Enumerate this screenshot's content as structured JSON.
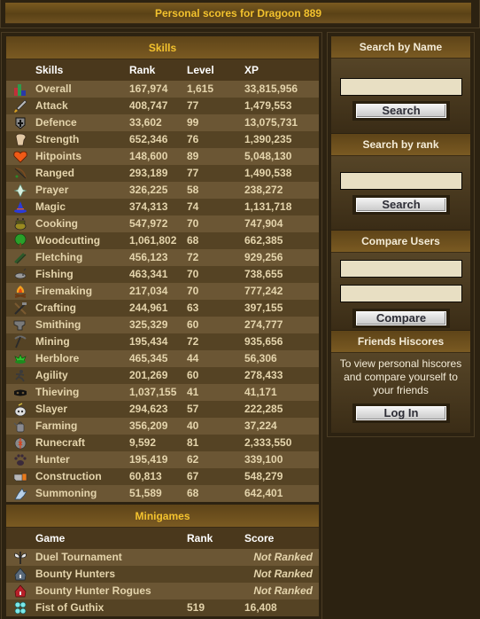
{
  "header": {
    "title": "Personal scores for Dragoon 889"
  },
  "skills": {
    "title": "Skills",
    "columns": [
      "Skills",
      "Rank",
      "Level",
      "XP"
    ],
    "rows": [
      {
        "icon": "overall-icon",
        "name": "Overall",
        "rank": "167,974",
        "level": "1,615",
        "xp": "33,815,956"
      },
      {
        "icon": "attack-icon",
        "name": "Attack",
        "rank": "408,747",
        "level": "77",
        "xp": "1,479,553"
      },
      {
        "icon": "defence-icon",
        "name": "Defence",
        "rank": "33,602",
        "level": "99",
        "xp": "13,075,731"
      },
      {
        "icon": "strength-icon",
        "name": "Strength",
        "rank": "652,346",
        "level": "76",
        "xp": "1,390,235"
      },
      {
        "icon": "hitpoints-icon",
        "name": "Hitpoints",
        "rank": "148,600",
        "level": "89",
        "xp": "5,048,130"
      },
      {
        "icon": "ranged-icon",
        "name": "Ranged",
        "rank": "293,189",
        "level": "77",
        "xp": "1,490,538"
      },
      {
        "icon": "prayer-icon",
        "name": "Prayer",
        "rank": "326,225",
        "level": "58",
        "xp": "238,272"
      },
      {
        "icon": "magic-icon",
        "name": "Magic",
        "rank": "374,313",
        "level": "74",
        "xp": "1,131,718"
      },
      {
        "icon": "cooking-icon",
        "name": "Cooking",
        "rank": "547,972",
        "level": "70",
        "xp": "747,904"
      },
      {
        "icon": "woodcutting-icon",
        "name": "Woodcutting",
        "rank": "1,061,802",
        "level": "68",
        "xp": "662,385"
      },
      {
        "icon": "fletching-icon",
        "name": "Fletching",
        "rank": "456,123",
        "level": "72",
        "xp": "929,256"
      },
      {
        "icon": "fishing-icon",
        "name": "Fishing",
        "rank": "463,341",
        "level": "70",
        "xp": "738,655"
      },
      {
        "icon": "firemaking-icon",
        "name": "Firemaking",
        "rank": "217,034",
        "level": "70",
        "xp": "777,242"
      },
      {
        "icon": "crafting-icon",
        "name": "Crafting",
        "rank": "244,961",
        "level": "63",
        "xp": "397,155"
      },
      {
        "icon": "smithing-icon",
        "name": "Smithing",
        "rank": "325,329",
        "level": "60",
        "xp": "274,777"
      },
      {
        "icon": "mining-icon",
        "name": "Mining",
        "rank": "195,434",
        "level": "72",
        "xp": "935,656"
      },
      {
        "icon": "herblore-icon",
        "name": "Herblore",
        "rank": "465,345",
        "level": "44",
        "xp": "56,306"
      },
      {
        "icon": "agility-icon",
        "name": "Agility",
        "rank": "201,269",
        "level": "60",
        "xp": "278,433"
      },
      {
        "icon": "thieving-icon",
        "name": "Thieving",
        "rank": "1,037,155",
        "level": "41",
        "xp": "41,171"
      },
      {
        "icon": "slayer-icon",
        "name": "Slayer",
        "rank": "294,623",
        "level": "57",
        "xp": "222,285"
      },
      {
        "icon": "farming-icon",
        "name": "Farming",
        "rank": "356,209",
        "level": "40",
        "xp": "37,224"
      },
      {
        "icon": "runecraft-icon",
        "name": "Runecraft",
        "rank": "9,592",
        "level": "81",
        "xp": "2,333,550"
      },
      {
        "icon": "hunter-icon",
        "name": "Hunter",
        "rank": "195,419",
        "level": "62",
        "xp": "339,100"
      },
      {
        "icon": "construction-icon",
        "name": "Construction",
        "rank": "60,813",
        "level": "67",
        "xp": "548,279"
      },
      {
        "icon": "summoning-icon",
        "name": "Summoning",
        "rank": "51,589",
        "level": "68",
        "xp": "642,401"
      }
    ]
  },
  "minigames": {
    "title": "Minigames",
    "columns": [
      "Game",
      "Rank",
      "Score"
    ],
    "rows": [
      {
        "icon": "duel-tournament-icon",
        "name": "Duel Tournament",
        "rank": "",
        "score": "Not Ranked",
        "ranked": false
      },
      {
        "icon": "bounty-hunters-icon",
        "name": "Bounty Hunters",
        "rank": "",
        "score": "Not Ranked",
        "ranked": false
      },
      {
        "icon": "bounty-hunter-rogues-icon",
        "name": "Bounty Hunter Rogues",
        "rank": "",
        "score": "Not Ranked",
        "ranked": false
      },
      {
        "icon": "fist-of-guthix-icon",
        "name": "Fist of Guthix",
        "rank": "519",
        "score": "16,408",
        "ranked": true
      }
    ]
  },
  "sidebar": {
    "search_name": {
      "title": "Search by Name",
      "input_value": "",
      "button": "Search"
    },
    "search_rank": {
      "title": "Search by rank",
      "input_value": "",
      "button": "Search"
    },
    "compare": {
      "title": "Compare Users",
      "input1_value": "",
      "input2_value": "",
      "button": "Compare"
    },
    "friends": {
      "title": "Friends Hiscores",
      "text": "To view personal hiscores and compare yourself to your friends",
      "button": "Log In"
    }
  },
  "colors": {
    "accent_gold": "#f3c22e",
    "row_light": "#6b5634",
    "row_dark": "#554324",
    "page_bg": "#2c2211"
  }
}
